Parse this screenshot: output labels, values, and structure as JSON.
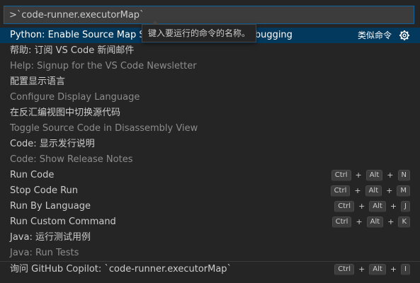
{
  "search": {
    "value": ">`code-runner.executorMap`"
  },
  "tooltip": "键入要运行的命令的名称。",
  "commands": [
    {
      "main": "Python: Enable Source Map Support for Extension Debugging",
      "selected": true,
      "similar": "类似命令",
      "gear": "gear-icon"
    },
    {
      "main": "帮助: 订阅 VS Code 新闻邮件",
      "detail": "Help: Signup for the VS Code Newsletter"
    },
    {
      "main": "配置显示语言",
      "detail": "Configure Display Language"
    },
    {
      "main": "在反汇编视图中切换源代码",
      "detail": "Toggle Source Code in Disassembly View"
    },
    {
      "main": "Code: 显示发行说明",
      "detail": "Code: Show Release Notes"
    },
    {
      "main": "Run Code",
      "keys": [
        "Ctrl",
        "Alt",
        "N"
      ]
    },
    {
      "main": "Stop Code Run",
      "keys": [
        "Ctrl",
        "Alt",
        "M"
      ]
    },
    {
      "main": "Run By Language",
      "keys": [
        "Ctrl",
        "Alt",
        "J"
      ]
    },
    {
      "main": "Run Custom Command",
      "keys": [
        "Ctrl",
        "Alt",
        "K"
      ]
    },
    {
      "main": "Java: 运行测试用例",
      "detail": "Java: Run Tests"
    },
    {
      "main": "询问 GitHub Copilot: `code-runner.executorMap`",
      "keys": [
        "Ctrl",
        "Alt",
        "I"
      ]
    }
  ]
}
